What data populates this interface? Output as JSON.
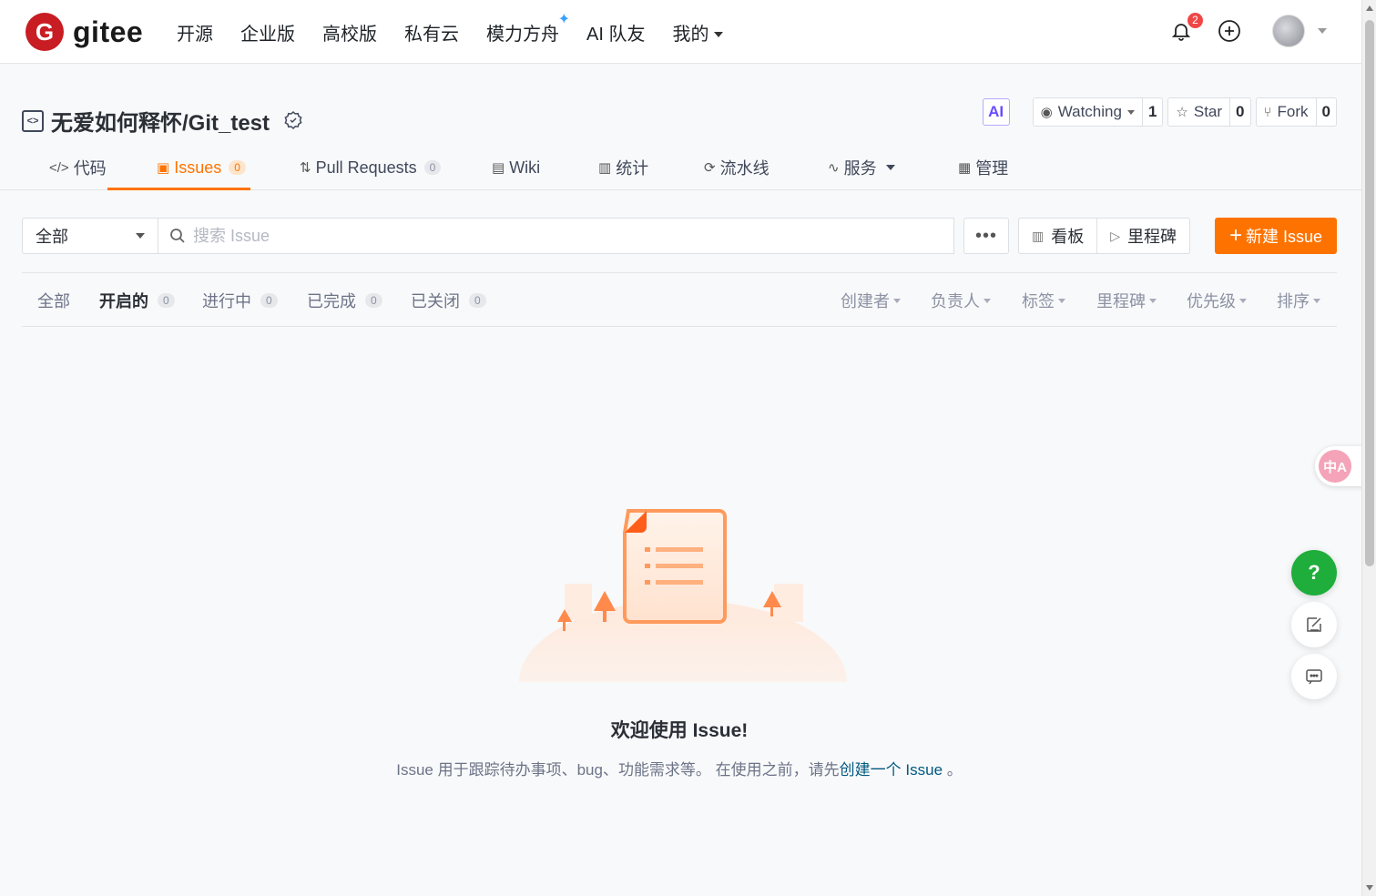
{
  "brand": {
    "name": "gitee",
    "mark": "G"
  },
  "nav": {
    "items": [
      "开源",
      "企业版",
      "高校版",
      "私有云",
      "模力方舟",
      "AI 队友",
      "我的"
    ],
    "spark": "✦"
  },
  "notifications": {
    "count": "2"
  },
  "project": {
    "repo_icon": "<>",
    "name": "无爱如何释怀/Git_test",
    "ai_label": "AI",
    "watch": {
      "label": "Watching",
      "count": "1"
    },
    "star": {
      "label": "Star",
      "count": "0"
    },
    "fork": {
      "label": "Fork",
      "count": "0"
    }
  },
  "tabs": [
    {
      "icon": "</>",
      "label": "代码"
    },
    {
      "icon": "▣",
      "label": "Issues",
      "count": "0"
    },
    {
      "icon": "⇅",
      "label": "Pull Requests",
      "count": "0"
    },
    {
      "icon": "▤",
      "label": "Wiki"
    },
    {
      "icon": "📊",
      "label": "统计"
    },
    {
      "icon": "⟳",
      "label": "流水线"
    },
    {
      "icon": "∿",
      "label": "服务"
    },
    {
      "icon": "▦",
      "label": "管理"
    }
  ],
  "toolbar": {
    "filter_value": "全部",
    "search_placeholder": "搜索 Issue",
    "more": "•••",
    "board_label": "看板",
    "milestone_label": "里程碑",
    "new_issue_label": "新建 Issue",
    "new_issue_plus": "+"
  },
  "status_filters": [
    {
      "label": "全部"
    },
    {
      "label": "开启的",
      "count": "0"
    },
    {
      "label": "进行中",
      "count": "0"
    },
    {
      "label": "已完成",
      "count": "0"
    },
    {
      "label": "已关闭",
      "count": "0"
    }
  ],
  "sort_filters": [
    "创建者",
    "负责人",
    "标签",
    "里程碑",
    "优先级",
    "排序"
  ],
  "empty": {
    "title": "欢迎使用 Issue!",
    "desc_prefix": "Issue 用于跟踪待办事项、bug、功能需求等。 在使用之前，请先",
    "desc_link": "创建一个 Issue",
    "desc_suffix": " 。"
  },
  "floating": {
    "translate": "中A",
    "help": "?"
  },
  "colors": {
    "brand": "#c71d23",
    "accent": "#fe7300",
    "help": "#1fae3b",
    "link": "#005980"
  }
}
